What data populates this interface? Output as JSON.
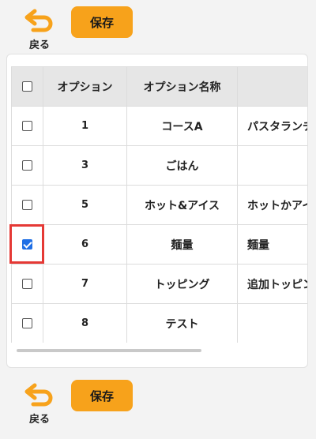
{
  "toolbar": {
    "back_label": "戻る",
    "save_label": "保存"
  },
  "table": {
    "headers": [
      "",
      "オプション",
      "オプション名称",
      ""
    ],
    "rows": [
      {
        "id": "1",
        "name": "コースA",
        "desc": "パスタランチ",
        "checked": false
      },
      {
        "id": "3",
        "name": "ごはん",
        "desc": "",
        "checked": false
      },
      {
        "id": "5",
        "name": "ホット&アイス",
        "desc": "ホットかアイス",
        "checked": false
      },
      {
        "id": "6",
        "name": "麺量",
        "desc": "麺量",
        "checked": true
      },
      {
        "id": "7",
        "name": "トッピング",
        "desc": "追加トッピング",
        "checked": false
      },
      {
        "id": "8",
        "name": "テスト",
        "desc": "",
        "checked": false
      }
    ]
  },
  "colors": {
    "accent": "#f7a21b",
    "highlight": "#e53935",
    "checkbox_checked": "#1f6fe5"
  }
}
